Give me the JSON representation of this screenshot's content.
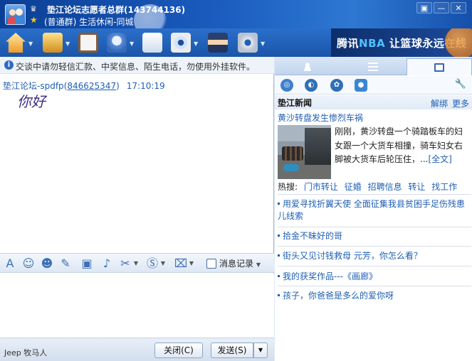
{
  "titlebar": {
    "group_title": "垫江论坛志愿者总群(143744136)",
    "group_subtitle": "(普通群) 生活休闲-同城",
    "controls": [
      "▣",
      "—",
      "✕"
    ]
  },
  "toolbar": {
    "icons": [
      "home-icon",
      "folder-icon",
      "album-icon",
      "mic-icon",
      "app-icon",
      "camera-icon",
      "police-icon",
      "gear-icon"
    ]
  },
  "ad": {
    "prefix": "腾讯",
    "brand": "NBA",
    "suffix": " 让篮球永远在线"
  },
  "chat": {
    "notice": "交谈中请勿轻信汇款、中奖信息、陌生电话，勿使用外挂软件。",
    "message": {
      "sender": "垫江论坛-spdfp",
      "qq": "846625347",
      "time": "17:10:19",
      "text": "你好"
    }
  },
  "format_bar": {
    "history_label": "消息记录"
  },
  "bottom": {
    "brand": "Jeep 牧马人",
    "close_label": "关闭(C)",
    "send_label": "发送(S)"
  },
  "side": {
    "news_title": "垫江新闻",
    "unlock": "解绑",
    "more": "更多",
    "headline": "黄沙转盘发生惨烈车祸",
    "summary": "刚刚，黄沙转盘一个骑踏板车的妇女跟一个大货车相撞，骑车妇女右脚被大货车后轮压住，...",
    "summary_more": "[全文]",
    "hot_label": "热搜:",
    "hot_keywords": [
      "门市转让",
      "征婚",
      "招聘信息",
      "转让",
      "找工作"
    ],
    "items": [
      "用爱寻找折翼天使 全面征集我县贫困手足伤残患儿线索",
      "拾金不昧好的哥",
      "街头又见讨钱救母 元芳，你怎么看？",
      "我的获奖作品---《画廊》",
      "孩子，你爸爸是多么的爱你呀"
    ]
  },
  "colors": {
    "title_blue": "#1a5bbd",
    "link_blue": "#1f5fb4",
    "message_purple": "#3a2f82"
  }
}
